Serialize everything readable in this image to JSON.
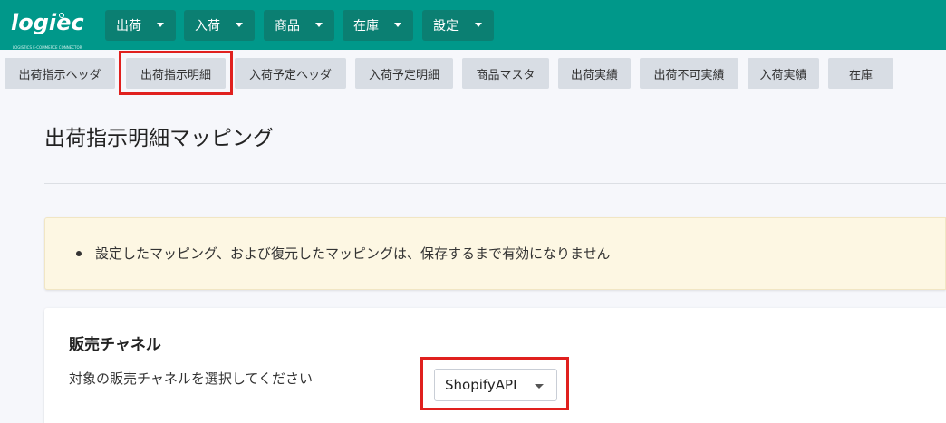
{
  "brand": {
    "name": "logiec",
    "tagline": "LOGISTICS E-COMMERCE CONNECTOR"
  },
  "nav": {
    "items": [
      {
        "label": "出荷"
      },
      {
        "label": "入荷"
      },
      {
        "label": "商品"
      },
      {
        "label": "在庫"
      },
      {
        "label": "設定"
      }
    ]
  },
  "subtabs": [
    {
      "label": "出荷指示ヘッダ"
    },
    {
      "label": "出荷指示明細",
      "selected": true
    },
    {
      "label": "入荷予定ヘッダ"
    },
    {
      "label": "入荷予定明細"
    },
    {
      "label": "商品マスタ"
    },
    {
      "label": "出荷実績"
    },
    {
      "label": "出荷不可実績"
    },
    {
      "label": "入荷実績"
    },
    {
      "label": "在庫"
    }
  ],
  "page": {
    "title": "出荷指示明細マッピング"
  },
  "notice": {
    "text": "設定したマッピング、および復元したマッピングは、保存するまで有効になりません"
  },
  "channel": {
    "title": "販売チャネル",
    "label": "対象の販売チャネルを選択してください",
    "selected": "ShopifyAPI"
  },
  "colors": {
    "header": "#00988a",
    "menu": "#0b7f72",
    "highlight": "#e0201e",
    "notice_bg": "#fdf7e3"
  },
  "icons": {
    "menu_caret": "chevron-down-icon",
    "select_caret": "chevron-down-icon",
    "notice_bullet": "bullet-icon"
  }
}
